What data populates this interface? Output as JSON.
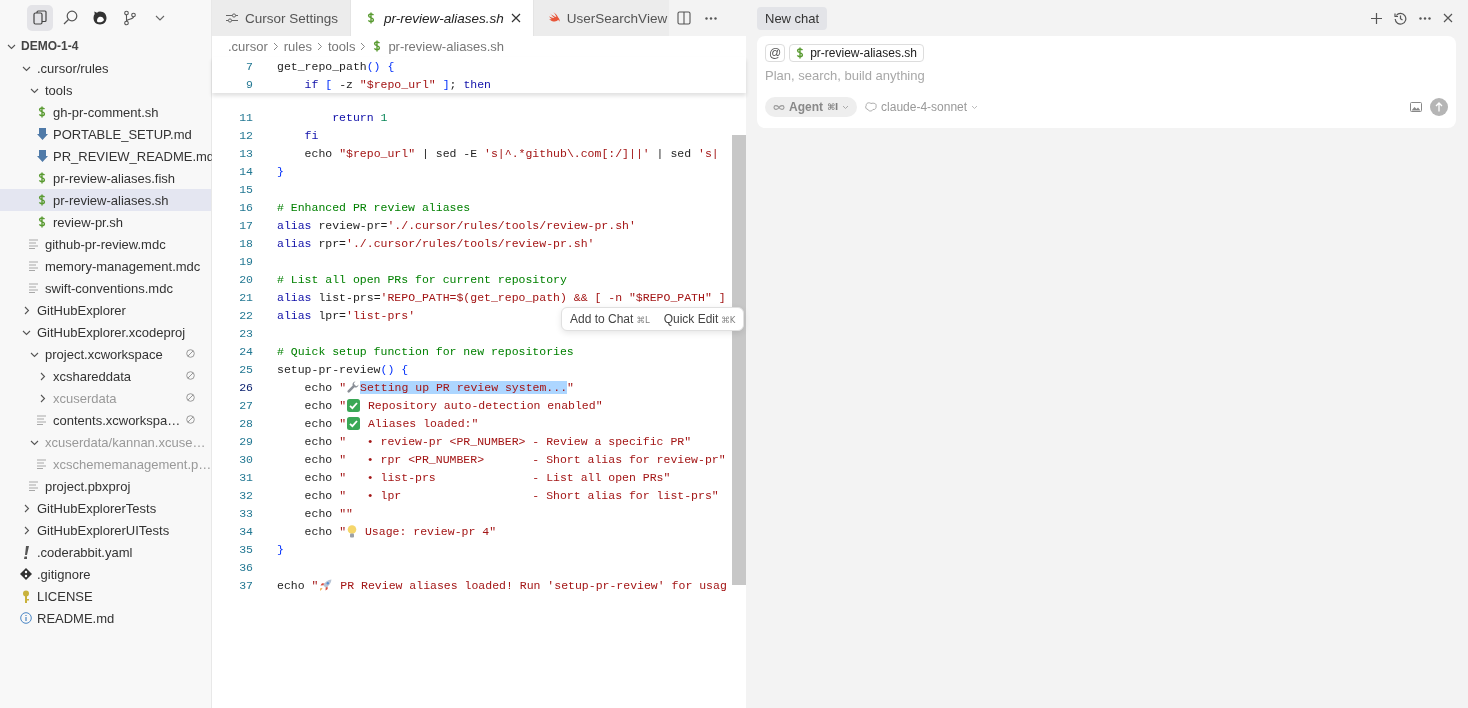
{
  "activity_bar": [
    {
      "kind": "files",
      "selected": true
    },
    {
      "kind": "search",
      "selected": false
    },
    {
      "kind": "cat",
      "selected": false
    },
    {
      "kind": "branch",
      "selected": false
    },
    {
      "kind": "chevron",
      "selected": false
    }
  ],
  "explorer": {
    "root": {
      "label": "DEMO-1-4",
      "expanded": true
    },
    "items": [
      {
        "label": ".cursor/rules",
        "kind": "folder",
        "expanded": true,
        "selected": false,
        "ignored": false,
        "dimmed": false,
        "children": [
          {
            "label": "tools",
            "kind": "folder",
            "expanded": true,
            "selected": false,
            "ignored": false,
            "dimmed": false,
            "children": [
              {
                "label": "gh-pr-comment.sh",
                "kind": "shell-file",
                "selected": false,
                "ignored": false,
                "dimmed": false
              },
              {
                "label": "PORTABLE_SETUP.md",
                "kind": "markdown-file",
                "selected": false,
                "ignored": false,
                "dimmed": false
              },
              {
                "label": "PR_REVIEW_README.md",
                "kind": "markdown-file",
                "selected": false,
                "ignored": false,
                "dimmed": false
              },
              {
                "label": "pr-review-aliases.fish",
                "kind": "shell-file",
                "selected": false,
                "ignored": false,
                "dimmed": false
              },
              {
                "label": "pr-review-aliases.sh",
                "kind": "shell-file",
                "selected": true,
                "ignored": false,
                "dimmed": false
              },
              {
                "label": "review-pr.sh",
                "kind": "shell-file",
                "selected": false,
                "ignored": false,
                "dimmed": false
              }
            ]
          },
          {
            "label": "github-pr-review.mdc",
            "kind": "text-file",
            "selected": false,
            "ignored": false,
            "dimmed": false
          },
          {
            "label": "memory-management.mdc",
            "kind": "text-file",
            "selected": false,
            "ignored": false,
            "dimmed": false
          },
          {
            "label": "swift-conventions.mdc",
            "kind": "text-file",
            "selected": false,
            "ignored": false,
            "dimmed": false
          }
        ]
      },
      {
        "label": "GitHubExplorer",
        "kind": "folder",
        "expanded": false,
        "selected": false,
        "ignored": false,
        "dimmed": false
      },
      {
        "label": "GitHubExplorer.xcodeproj",
        "kind": "folder",
        "expanded": true,
        "selected": false,
        "ignored": false,
        "dimmed": false,
        "children": [
          {
            "label": "project.xcworkspace",
            "kind": "folder",
            "expanded": true,
            "selected": false,
            "ignored": true,
            "dimmed": false,
            "children": [
              {
                "label": "xcshareddata",
                "kind": "folder",
                "expanded": false,
                "selected": false,
                "ignored": true,
                "dimmed": false
              },
              {
                "label": "xcuserdata",
                "kind": "folder",
                "expanded": false,
                "selected": false,
                "ignored": true,
                "dimmed": true
              },
              {
                "label": "contents.xcworkspa…",
                "kind": "text-file",
                "selected": false,
                "ignored": true,
                "dimmed": false
              }
            ]
          },
          {
            "label": "xcuserdata/kannan.xcuse…",
            "kind": "folder",
            "expanded": true,
            "selected": false,
            "ignored": false,
            "dimmed": true,
            "children": [
              {
                "label": "xcschememanagement.p…",
                "kind": "text-file",
                "selected": false,
                "ignored": false,
                "dimmed": true
              }
            ]
          },
          {
            "label": "project.pbxproj",
            "kind": "text-file",
            "selected": false,
            "ignored": false,
            "dimmed": false
          }
        ]
      },
      {
        "label": "GitHubExplorerTests",
        "kind": "folder",
        "expanded": false,
        "selected": false,
        "ignored": false,
        "dimmed": false
      },
      {
        "label": "GitHubExplorerUITests",
        "kind": "folder",
        "expanded": false,
        "selected": false,
        "ignored": false,
        "dimmed": false
      },
      {
        "label": ".coderabbit.yaml",
        "kind": "yaml-file",
        "selected": false,
        "ignored": false,
        "dimmed": false
      },
      {
        "label": ".gitignore",
        "kind": "git-file",
        "selected": false,
        "ignored": false,
        "dimmed": false
      },
      {
        "label": "LICENSE",
        "kind": "license-file",
        "selected": false,
        "ignored": false,
        "dimmed": false
      },
      {
        "label": "README.md",
        "kind": "info-file",
        "selected": false,
        "ignored": false,
        "dimmed": false
      }
    ]
  },
  "tabs": [
    {
      "label": "Cursor Settings",
      "kind": "settings",
      "selected": false
    },
    {
      "label": "pr-review-aliases.sh",
      "kind": "shell-file",
      "selected": true
    },
    {
      "label": "UserSearchView",
      "kind": "swift-file",
      "selected": false
    }
  ],
  "breadcrumb": [
    {
      "label": ".cursor",
      "kind": "folder"
    },
    {
      "label": "rules",
      "kind": "folder"
    },
    {
      "label": "tools",
      "kind": "folder"
    },
    {
      "label": "pr-review-aliases.sh",
      "kind": "shell-file"
    }
  ],
  "sticky_lines": [
    {
      "number": "7",
      "tokens": [
        {
          "kind": "plain",
          "text": "get_repo_path"
        },
        {
          "kind": "brace",
          "text": "() {"
        }
      ]
    },
    {
      "number": "9",
      "tokens": [
        {
          "kind": "keyword",
          "text": "    if"
        },
        {
          "kind": "brace",
          "text": " ["
        },
        {
          "kind": "plain",
          "text": " -z "
        },
        {
          "kind": "string",
          "text": "\"$repo_url\""
        },
        {
          "kind": "brace",
          "text": " ]"
        },
        {
          "kind": "plain",
          "text": "; "
        },
        {
          "kind": "keyword",
          "text": "then"
        }
      ]
    }
  ],
  "code_lines": [
    {
      "number": "11",
      "current": false,
      "tokens": [
        {
          "kind": "keyword",
          "text": "        return"
        },
        {
          "kind": "number",
          "text": " 1"
        }
      ]
    },
    {
      "number": "12",
      "current": false,
      "tokens": [
        {
          "kind": "keyword",
          "text": "    fi"
        }
      ]
    },
    {
      "number": "13",
      "current": false,
      "tokens": [
        {
          "kind": "plain",
          "text": "    echo "
        },
        {
          "kind": "string",
          "text": "\"$repo_url\""
        },
        {
          "kind": "plain",
          "text": " | sed -E "
        },
        {
          "kind": "string",
          "text": "'s|^.*github\\.com[:/]||'"
        },
        {
          "kind": "plain",
          "text": " | sed "
        },
        {
          "kind": "string",
          "text": "'s|"
        }
      ]
    },
    {
      "number": "14",
      "current": false,
      "tokens": [
        {
          "kind": "brace",
          "text": "}"
        }
      ]
    },
    {
      "number": "15",
      "current": false
    },
    {
      "number": "16",
      "current": false,
      "tokens": [
        {
          "kind": "comment",
          "text": "# Enhanced PR review aliases"
        }
      ]
    },
    {
      "number": "17",
      "current": false,
      "tokens": [
        {
          "kind": "keyword",
          "text": "alias"
        },
        {
          "kind": "plain",
          "text": " review-pr="
        },
        {
          "kind": "string",
          "text": "'./.cursor/rules/tools/review-pr.sh'"
        }
      ]
    },
    {
      "number": "18",
      "current": false,
      "tokens": [
        {
          "kind": "keyword",
          "text": "alias"
        },
        {
          "kind": "plain",
          "text": " rpr="
        },
        {
          "kind": "string",
          "text": "'./.cursor/rules/tools/review-pr.sh'"
        }
      ]
    },
    {
      "number": "19",
      "current": false
    },
    {
      "number": "20",
      "current": false,
      "tokens": [
        {
          "kind": "comment",
          "text": "# List all open PRs for current repository"
        }
      ]
    },
    {
      "number": "21",
      "current": false,
      "tokens": [
        {
          "kind": "keyword",
          "text": "alias"
        },
        {
          "kind": "plain",
          "text": " list-prs="
        },
        {
          "kind": "string",
          "text": "'REPO_PATH=$(get_repo_path) && [ -n \"$REPO_PATH\" ]"
        }
      ]
    },
    {
      "number": "22",
      "current": false,
      "tokens": [
        {
          "kind": "keyword",
          "text": "alias"
        },
        {
          "kind": "plain",
          "text": " lpr="
        },
        {
          "kind": "string",
          "text": "'list-prs'"
        }
      ]
    },
    {
      "number": "23",
      "current": false
    },
    {
      "number": "24",
      "current": false,
      "tokens": [
        {
          "kind": "comment",
          "text": "# Quick setup function for new repositories"
        }
      ]
    },
    {
      "number": "25",
      "current": false,
      "tokens": [
        {
          "kind": "plain",
          "text": "setup-pr-review"
        },
        {
          "kind": "brace",
          "text": "() {"
        }
      ]
    },
    {
      "number": "26",
      "current": true,
      "tokens": [
        {
          "kind": "plain",
          "text": "    echo "
        },
        {
          "kind": "string",
          "text": "\""
        },
        {
          "kind": "wrench"
        },
        {
          "kind": "selection",
          "text": "Setting up PR review system..."
        },
        {
          "kind": "string",
          "text": "\""
        }
      ]
    },
    {
      "number": "27",
      "current": false,
      "tokens": [
        {
          "kind": "plain",
          "text": "    echo "
        },
        {
          "kind": "string",
          "text": "\""
        },
        {
          "kind": "check"
        },
        {
          "kind": "string",
          "text": " Repository auto-detection enabled\""
        }
      ]
    },
    {
      "number": "28",
      "current": false,
      "tokens": [
        {
          "kind": "plain",
          "text": "    echo "
        },
        {
          "kind": "string",
          "text": "\""
        },
        {
          "kind": "check"
        },
        {
          "kind": "string",
          "text": " Aliases loaded:\""
        }
      ]
    },
    {
      "number": "29",
      "current": false,
      "tokens": [
        {
          "kind": "plain",
          "text": "    echo "
        },
        {
          "kind": "string",
          "text": "\"   • review-pr <PR_NUMBER> - Review a specific PR\""
        }
      ]
    },
    {
      "number": "30",
      "current": false,
      "tokens": [
        {
          "kind": "plain",
          "text": "    echo "
        },
        {
          "kind": "string",
          "text": "\"   • rpr <PR_NUMBER>       - Short alias for review-pr\""
        }
      ]
    },
    {
      "number": "31",
      "current": false,
      "tokens": [
        {
          "kind": "plain",
          "text": "    echo "
        },
        {
          "kind": "string",
          "text": "\"   • list-prs              - List all open PRs\""
        }
      ]
    },
    {
      "number": "32",
      "current": false,
      "tokens": [
        {
          "kind": "plain",
          "text": "    echo "
        },
        {
          "kind": "string",
          "text": "\"   • lpr                   - Short alias for list-prs\""
        }
      ]
    },
    {
      "number": "33",
      "current": false,
      "tokens": [
        {
          "kind": "plain",
          "text": "    echo "
        },
        {
          "kind": "string",
          "text": "\"\""
        }
      ]
    },
    {
      "number": "34",
      "current": false,
      "tokens": [
        {
          "kind": "plain",
          "text": "    echo "
        },
        {
          "kind": "string",
          "text": "\""
        },
        {
          "kind": "bulb"
        },
        {
          "kind": "string",
          "text": " Usage: review-pr 4\""
        }
      ]
    },
    {
      "number": "35",
      "current": false,
      "tokens": [
        {
          "kind": "brace",
          "text": "}"
        }
      ]
    },
    {
      "number": "36",
      "current": false
    },
    {
      "number": "37",
      "current": false,
      "tokens": [
        {
          "kind": "plain",
          "text": "echo "
        },
        {
          "kind": "string",
          "text": "\""
        },
        {
          "kind": "rocket"
        },
        {
          "kind": "string",
          "text": " PR Review aliases loaded! Run 'setup-pr-review' for usag"
        }
      ]
    }
  ],
  "selection_menu": [
    {
      "label": "Add to Chat",
      "shortcut": "⌘L"
    },
    {
      "label": "Quick Edit",
      "shortcut": "⌘K"
    }
  ],
  "chat": {
    "tab": "New chat",
    "mention": "@",
    "context_file": "pr-review-aliases.sh",
    "placeholder": "Plan, search, build anything",
    "mode": {
      "label": "Agent",
      "shortcut": "⌘I"
    },
    "model": "claude-4-sonnet"
  }
}
